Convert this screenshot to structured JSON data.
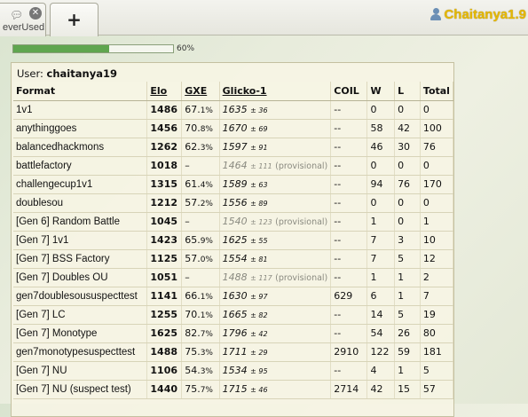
{
  "tabs": {
    "previous_label": "everUsed",
    "new_tab_label": "+"
  },
  "user_menu": {
    "username": "Chaitanya1.9"
  },
  "progress": {
    "percent": 60,
    "label": "60%"
  },
  "stats_panel": {
    "user_prefix": "User: ",
    "user_name": "chaitanya19",
    "columns": [
      "Format",
      "Elo",
      "GXE",
      "Glicko-1",
      "COIL",
      "W",
      "L",
      "Total"
    ],
    "rows": [
      {
        "format": "1v1",
        "elo": "1486",
        "gxe_int": "67.",
        "gxe_dec": "1%",
        "glicko": "1635",
        "dev": "± 36",
        "prov": "",
        "coil": "--",
        "w": "0",
        "l": "0",
        "total": "0"
      },
      {
        "format": "anythinggoes",
        "elo": "1456",
        "gxe_int": "70.",
        "gxe_dec": "8%",
        "glicko": "1670",
        "dev": "± 69",
        "prov": "",
        "coil": "--",
        "w": "58",
        "l": "42",
        "total": "100"
      },
      {
        "format": "balancedhackmons",
        "elo": "1262",
        "gxe_int": "62.",
        "gxe_dec": "3%",
        "glicko": "1597",
        "dev": "± 91",
        "prov": "",
        "coil": "--",
        "w": "46",
        "l": "30",
        "total": "76"
      },
      {
        "format": "battlefactory",
        "elo": "1018",
        "gxe_int": "–",
        "gxe_dec": "",
        "glicko": "1464",
        "dev": "± 111",
        "prov": "(provisional)",
        "coil": "--",
        "w": "0",
        "l": "0",
        "total": "0"
      },
      {
        "format": "challengecup1v1",
        "elo": "1315",
        "gxe_int": "61.",
        "gxe_dec": "4%",
        "glicko": "1589",
        "dev": "± 63",
        "prov": "",
        "coil": "--",
        "w": "94",
        "l": "76",
        "total": "170"
      },
      {
        "format": "doublesou",
        "elo": "1212",
        "gxe_int": "57.",
        "gxe_dec": "2%",
        "glicko": "1556",
        "dev": "± 89",
        "prov": "",
        "coil": "--",
        "w": "0",
        "l": "0",
        "total": "0"
      },
      {
        "format": "[Gen 6] Random Battle",
        "elo": "1045",
        "gxe_int": "–",
        "gxe_dec": "",
        "glicko": "1540",
        "dev": "± 123",
        "prov": "(provisional)",
        "coil": "--",
        "w": "1",
        "l": "0",
        "total": "1"
      },
      {
        "format": "[Gen 7] 1v1",
        "elo": "1423",
        "gxe_int": "65.",
        "gxe_dec": "9%",
        "glicko": "1625",
        "dev": "± 55",
        "prov": "",
        "coil": "--",
        "w": "7",
        "l": "3",
        "total": "10"
      },
      {
        "format": "[Gen 7] BSS Factory",
        "elo": "1125",
        "gxe_int": "57.",
        "gxe_dec": "0%",
        "glicko": "1554",
        "dev": "± 81",
        "prov": "",
        "coil": "--",
        "w": "7",
        "l": "5",
        "total": "12"
      },
      {
        "format": "[Gen 7] Doubles OU",
        "elo": "1051",
        "gxe_int": "–",
        "gxe_dec": "",
        "glicko": "1488",
        "dev": "± 117",
        "prov": "(provisional)",
        "coil": "--",
        "w": "1",
        "l": "1",
        "total": "2"
      },
      {
        "format": "gen7doublesoususpecttest",
        "elo": "1141",
        "gxe_int": "66.",
        "gxe_dec": "1%",
        "glicko": "1630",
        "dev": "± 97",
        "prov": "",
        "coil": "629",
        "w": "6",
        "l": "1",
        "total": "7"
      },
      {
        "format": "[Gen 7] LC",
        "elo": "1255",
        "gxe_int": "70.",
        "gxe_dec": "1%",
        "glicko": "1665",
        "dev": "± 82",
        "prov": "",
        "coil": "--",
        "w": "14",
        "l": "5",
        "total": "19"
      },
      {
        "format": "[Gen 7] Monotype",
        "elo": "1625",
        "gxe_int": "82.",
        "gxe_dec": "7%",
        "glicko": "1796",
        "dev": "± 42",
        "prov": "",
        "coil": "--",
        "w": "54",
        "l": "26",
        "total": "80"
      },
      {
        "format": "gen7monotypesuspecttest",
        "elo": "1488",
        "gxe_int": "75.",
        "gxe_dec": "3%",
        "glicko": "1711",
        "dev": "± 29",
        "prov": "",
        "coil": "2910",
        "w": "122",
        "l": "59",
        "total": "181"
      },
      {
        "format": "[Gen 7] NU",
        "elo": "1106",
        "gxe_int": "54.",
        "gxe_dec": "3%",
        "glicko": "1534",
        "dev": "± 95",
        "prov": "",
        "coil": "--",
        "w": "4",
        "l": "1",
        "total": "5"
      },
      {
        "format": "[Gen 7] NU (suspect test)",
        "elo": "1440",
        "gxe_int": "75.",
        "gxe_dec": "7%",
        "glicko": "1715",
        "dev": "± 46",
        "prov": "",
        "coil": "2714",
        "w": "42",
        "l": "15",
        "total": "57"
      }
    ]
  }
}
